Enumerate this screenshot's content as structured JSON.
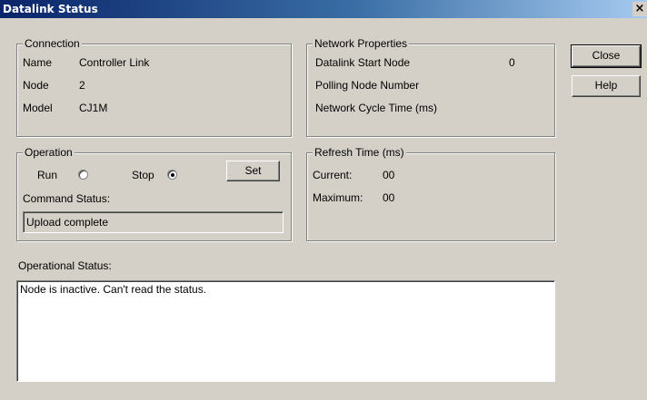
{
  "window": {
    "title": "Datalink Status",
    "close_glyph": "×"
  },
  "connection": {
    "legend": "Connection",
    "rows": [
      {
        "label": "Name",
        "value": "Controller Link"
      },
      {
        "label": "Node",
        "value": "2"
      },
      {
        "label": "Model",
        "value": "CJ1M"
      }
    ]
  },
  "network": {
    "legend": "Network Properties",
    "start_node_label": "Datalink Start Node",
    "start_node_value": "0",
    "polling_label": "Polling Node Number",
    "cycle_label": "Network Cycle Time (ms)"
  },
  "operation": {
    "legend": "Operation",
    "run_label": "Run",
    "stop_label": "Stop",
    "selected": "stop",
    "set_label": "Set",
    "command_status_label": "Command Status:",
    "command_status_value": "Upload complete"
  },
  "refresh": {
    "legend": "Refresh Time (ms)",
    "current_label": "Current:",
    "current_value": "00",
    "maximum_label": "Maximum:",
    "maximum_value": "00"
  },
  "buttons": {
    "close": "Close",
    "help": "Help"
  },
  "operational_status": {
    "label": "Operational Status:",
    "text": "Node is inactive. Can't read the status."
  }
}
